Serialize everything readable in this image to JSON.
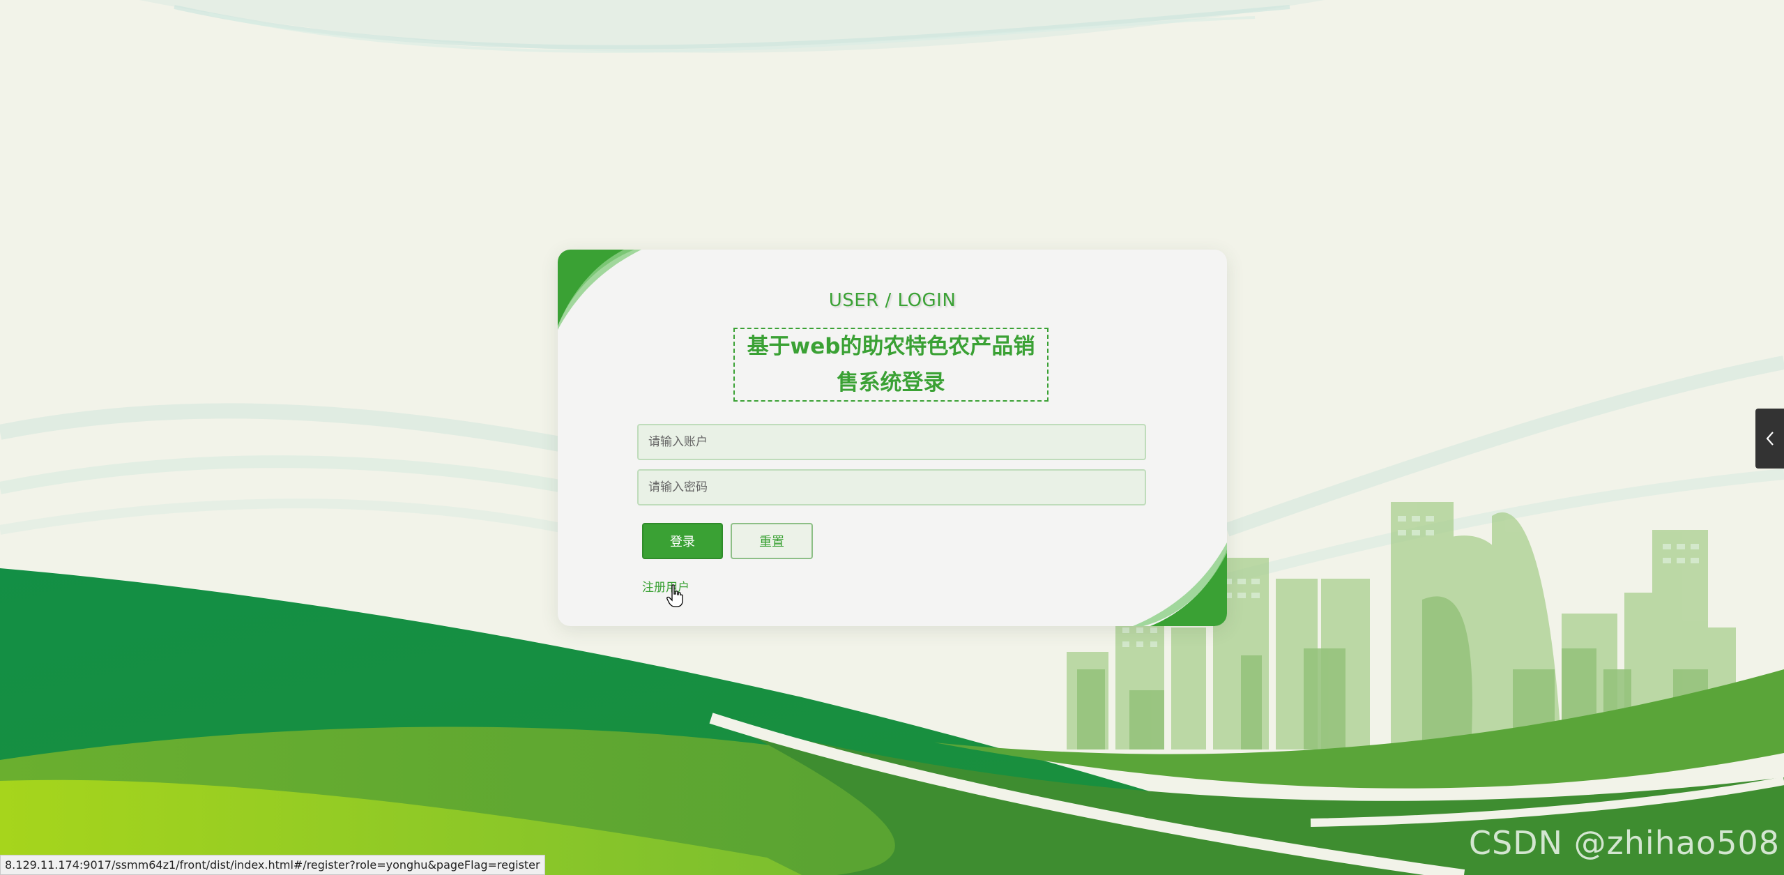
{
  "login": {
    "heading_en": "USER / LOGIN",
    "title": "基于web的助农特色农产品销售系统登录",
    "account_placeholder": "请输入账户",
    "password_placeholder": "请输入密码",
    "login_button": "登录",
    "reset_button": "重置",
    "register_link": "注册用户"
  },
  "status_bar": {
    "url": "8.129.11.174:9017/ssmm64z1/front/dist/index.html#/register?role=yonghu&pageFlag=register"
  },
  "watermark": "CSDN @zhihao508",
  "side_tab": {
    "icon": "chevron-left-icon"
  },
  "colors": {
    "accent_green": "#3aa134",
    "side_tab_bg": "#333333"
  }
}
